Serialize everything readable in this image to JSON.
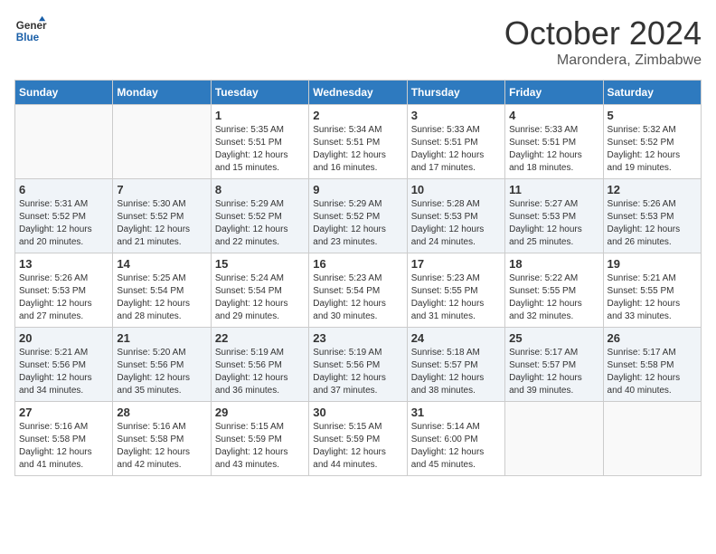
{
  "header": {
    "logo_line1": "General",
    "logo_line2": "Blue",
    "month": "October 2024",
    "location": "Marondera, Zimbabwe"
  },
  "weekdays": [
    "Sunday",
    "Monday",
    "Tuesday",
    "Wednesday",
    "Thursday",
    "Friday",
    "Saturday"
  ],
  "weeks": [
    [
      {
        "day": "",
        "info": ""
      },
      {
        "day": "",
        "info": ""
      },
      {
        "day": "1",
        "info": "Sunrise: 5:35 AM\nSunset: 5:51 PM\nDaylight: 12 hours and 15 minutes."
      },
      {
        "day": "2",
        "info": "Sunrise: 5:34 AM\nSunset: 5:51 PM\nDaylight: 12 hours and 16 minutes."
      },
      {
        "day": "3",
        "info": "Sunrise: 5:33 AM\nSunset: 5:51 PM\nDaylight: 12 hours and 17 minutes."
      },
      {
        "day": "4",
        "info": "Sunrise: 5:33 AM\nSunset: 5:51 PM\nDaylight: 12 hours and 18 minutes."
      },
      {
        "day": "5",
        "info": "Sunrise: 5:32 AM\nSunset: 5:52 PM\nDaylight: 12 hours and 19 minutes."
      }
    ],
    [
      {
        "day": "6",
        "info": "Sunrise: 5:31 AM\nSunset: 5:52 PM\nDaylight: 12 hours and 20 minutes."
      },
      {
        "day": "7",
        "info": "Sunrise: 5:30 AM\nSunset: 5:52 PM\nDaylight: 12 hours and 21 minutes."
      },
      {
        "day": "8",
        "info": "Sunrise: 5:29 AM\nSunset: 5:52 PM\nDaylight: 12 hours and 22 minutes."
      },
      {
        "day": "9",
        "info": "Sunrise: 5:29 AM\nSunset: 5:52 PM\nDaylight: 12 hours and 23 minutes."
      },
      {
        "day": "10",
        "info": "Sunrise: 5:28 AM\nSunset: 5:53 PM\nDaylight: 12 hours and 24 minutes."
      },
      {
        "day": "11",
        "info": "Sunrise: 5:27 AM\nSunset: 5:53 PM\nDaylight: 12 hours and 25 minutes."
      },
      {
        "day": "12",
        "info": "Sunrise: 5:26 AM\nSunset: 5:53 PM\nDaylight: 12 hours and 26 minutes."
      }
    ],
    [
      {
        "day": "13",
        "info": "Sunrise: 5:26 AM\nSunset: 5:53 PM\nDaylight: 12 hours and 27 minutes."
      },
      {
        "day": "14",
        "info": "Sunrise: 5:25 AM\nSunset: 5:54 PM\nDaylight: 12 hours and 28 minutes."
      },
      {
        "day": "15",
        "info": "Sunrise: 5:24 AM\nSunset: 5:54 PM\nDaylight: 12 hours and 29 minutes."
      },
      {
        "day": "16",
        "info": "Sunrise: 5:23 AM\nSunset: 5:54 PM\nDaylight: 12 hours and 30 minutes."
      },
      {
        "day": "17",
        "info": "Sunrise: 5:23 AM\nSunset: 5:55 PM\nDaylight: 12 hours and 31 minutes."
      },
      {
        "day": "18",
        "info": "Sunrise: 5:22 AM\nSunset: 5:55 PM\nDaylight: 12 hours and 32 minutes."
      },
      {
        "day": "19",
        "info": "Sunrise: 5:21 AM\nSunset: 5:55 PM\nDaylight: 12 hours and 33 minutes."
      }
    ],
    [
      {
        "day": "20",
        "info": "Sunrise: 5:21 AM\nSunset: 5:56 PM\nDaylight: 12 hours and 34 minutes."
      },
      {
        "day": "21",
        "info": "Sunrise: 5:20 AM\nSunset: 5:56 PM\nDaylight: 12 hours and 35 minutes."
      },
      {
        "day": "22",
        "info": "Sunrise: 5:19 AM\nSunset: 5:56 PM\nDaylight: 12 hours and 36 minutes."
      },
      {
        "day": "23",
        "info": "Sunrise: 5:19 AM\nSunset: 5:56 PM\nDaylight: 12 hours and 37 minutes."
      },
      {
        "day": "24",
        "info": "Sunrise: 5:18 AM\nSunset: 5:57 PM\nDaylight: 12 hours and 38 minutes."
      },
      {
        "day": "25",
        "info": "Sunrise: 5:17 AM\nSunset: 5:57 PM\nDaylight: 12 hours and 39 minutes."
      },
      {
        "day": "26",
        "info": "Sunrise: 5:17 AM\nSunset: 5:58 PM\nDaylight: 12 hours and 40 minutes."
      }
    ],
    [
      {
        "day": "27",
        "info": "Sunrise: 5:16 AM\nSunset: 5:58 PM\nDaylight: 12 hours and 41 minutes."
      },
      {
        "day": "28",
        "info": "Sunrise: 5:16 AM\nSunset: 5:58 PM\nDaylight: 12 hours and 42 minutes."
      },
      {
        "day": "29",
        "info": "Sunrise: 5:15 AM\nSunset: 5:59 PM\nDaylight: 12 hours and 43 minutes."
      },
      {
        "day": "30",
        "info": "Sunrise: 5:15 AM\nSunset: 5:59 PM\nDaylight: 12 hours and 44 minutes."
      },
      {
        "day": "31",
        "info": "Sunrise: 5:14 AM\nSunset: 6:00 PM\nDaylight: 12 hours and 45 minutes."
      },
      {
        "day": "",
        "info": ""
      },
      {
        "day": "",
        "info": ""
      }
    ]
  ]
}
